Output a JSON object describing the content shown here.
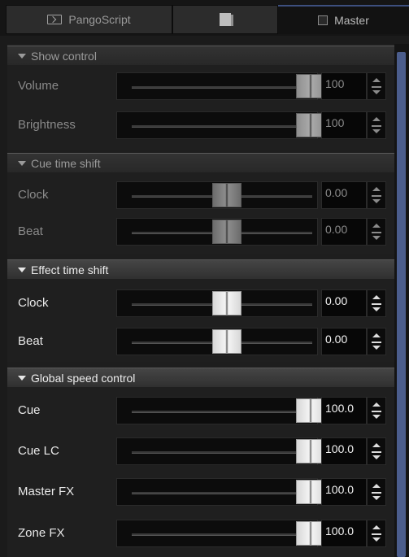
{
  "tabs": [
    {
      "label": "PangoScript",
      "icon": "script-icon",
      "active": false
    },
    {
      "label": "",
      "icon": "document-icon",
      "active": false
    },
    {
      "label": "Master",
      "icon": "master-icon",
      "active": true
    }
  ],
  "sections": [
    {
      "title": "Show control",
      "enabled": false,
      "rows": [
        {
          "label": "Volume",
          "value": "100",
          "position": 1.0
        },
        {
          "label": "Brightness",
          "value": "100",
          "position": 1.0
        }
      ]
    },
    {
      "title": "Cue time shift",
      "enabled": false,
      "rows": [
        {
          "label": "Clock",
          "value": "0.00",
          "position": 0.5
        },
        {
          "label": "Beat",
          "value": "0.00",
          "position": 0.5
        }
      ]
    },
    {
      "title": "Effect time shift",
      "enabled": true,
      "rows": [
        {
          "label": "Clock",
          "value": "0.00",
          "position": 0.5
        },
        {
          "label": "Beat",
          "value": "0.00",
          "position": 0.5
        }
      ]
    },
    {
      "title": "Global speed control",
      "enabled": true,
      "rows": [
        {
          "label": "Cue",
          "value": "100.0",
          "position": 1.0
        },
        {
          "label": "Cue LC",
          "value": "100.0",
          "position": 1.0
        },
        {
          "label": "Master FX",
          "value": "100.0",
          "position": 1.0
        },
        {
          "label": "Zone FX",
          "value": "100.0",
          "position": 1.0
        }
      ]
    }
  ],
  "colors": {
    "scrollbar": "#4b5d8c",
    "active_tab_accent": "#3d4f7e"
  }
}
